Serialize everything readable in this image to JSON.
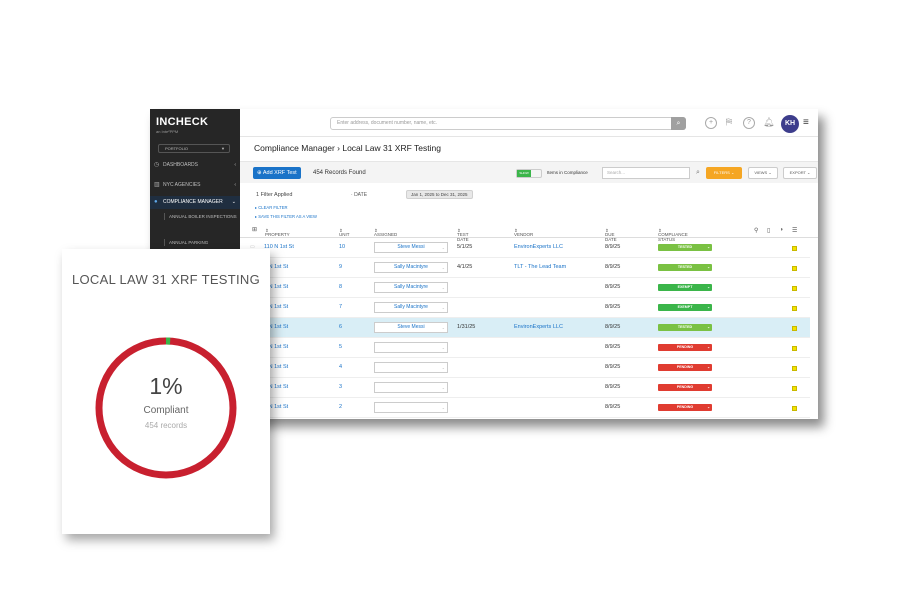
{
  "app": {
    "logo": "INCHECK",
    "logo_sub": "an Inte²PPM",
    "portfolio": "PORTFOLIO",
    "search_placeholder": "Enter address, document number, name, etc.",
    "avatar": "KH"
  },
  "sidebar": {
    "items": [
      {
        "label": "DASHBOARDS"
      },
      {
        "label": "NYC AGENCIES"
      },
      {
        "label": "COMPLIANCE MANAGER"
      }
    ],
    "subitems": [
      "ANNUAL BOILER INSPECTIONS",
      "ANNUAL PARKING"
    ]
  },
  "page": {
    "breadcrumb": "Compliance Manager › Local Law 31 XRF Testing"
  },
  "toolbar": {
    "add_button": "Add XRF Test",
    "records_found": "454 Records Found",
    "toggle_on": "SHOW",
    "toggle_label": "Items in Compliance",
    "search_placeholder": "Search...",
    "filters": "FILTERS",
    "views": "VIEWS",
    "export": "EXPORT"
  },
  "filters": {
    "applied": "1 Filter Applied",
    "date_label": "DATE",
    "date_range": "Jan 1, 2025 to Dec 31, 2025",
    "clear": "CLEAR FILTER",
    "save": "SAVE THIS FILTER AS A VIEW"
  },
  "table": {
    "headers": {
      "property": "PROPERTY",
      "unit": "UNIT",
      "assigned": "ASSIGNED",
      "test_date": "TEST DATE",
      "vendor": "VENDOR",
      "due_date": "DUE DATE",
      "status": "COMPLIANCE STATUS"
    },
    "rows": [
      {
        "property": "110 N 1st St",
        "unit": "10",
        "assigned": "Steve Messi",
        "test_date": "5/1/25",
        "vendor": "EnvironExperts LLC",
        "due_date": "8/9/25",
        "status": "TESTED"
      },
      {
        "property": "0 N 1st St",
        "unit": "9",
        "assigned": "Sally Macintyre",
        "test_date": "4/1/25",
        "vendor": "TLT - The Lead Team",
        "due_date": "8/9/25",
        "status": "TESTED"
      },
      {
        "property": "0 N 1st St",
        "unit": "8",
        "assigned": "Sally Macintyre",
        "test_date": "",
        "vendor": "",
        "due_date": "8/9/25",
        "status": "EXEMPT"
      },
      {
        "property": "0 N 1st St",
        "unit": "7",
        "assigned": "Sally Macintyre",
        "test_date": "",
        "vendor": "",
        "due_date": "8/9/25",
        "status": "EXEMPT"
      },
      {
        "property": "0 N 1st St",
        "unit": "6",
        "assigned": "Steve Messi",
        "test_date": "1/31/25",
        "vendor": "EnvironExperts LLC",
        "due_date": "8/9/25",
        "status": "TESTED"
      },
      {
        "property": "0 N 1st St",
        "unit": "5",
        "assigned": "",
        "test_date": "",
        "vendor": "",
        "due_date": "8/9/25",
        "status": "PENDING"
      },
      {
        "property": "0 N 1st St",
        "unit": "4",
        "assigned": "",
        "test_date": "",
        "vendor": "",
        "due_date": "8/9/25",
        "status": "PENDING"
      },
      {
        "property": "0 N 1st St",
        "unit": "3",
        "assigned": "",
        "test_date": "",
        "vendor": "",
        "due_date": "8/9/25",
        "status": "PENDING"
      },
      {
        "property": "0 N 1st St",
        "unit": "2",
        "assigned": "",
        "test_date": "",
        "vendor": "",
        "due_date": "8/9/25",
        "status": "PENDING"
      }
    ]
  },
  "status_colors": {
    "TESTED": "#7ac143",
    "EXEMPT": "#3bb54a",
    "PENDING": "#e03c31"
  },
  "widget": {
    "title": "LOCAL LAW 31 XRF TESTING",
    "percent": "1%",
    "percent_value": 1,
    "label": "Compliant",
    "records": "454 records",
    "ring_color": "#c8202f",
    "compliant_color": "#3bb54a"
  }
}
